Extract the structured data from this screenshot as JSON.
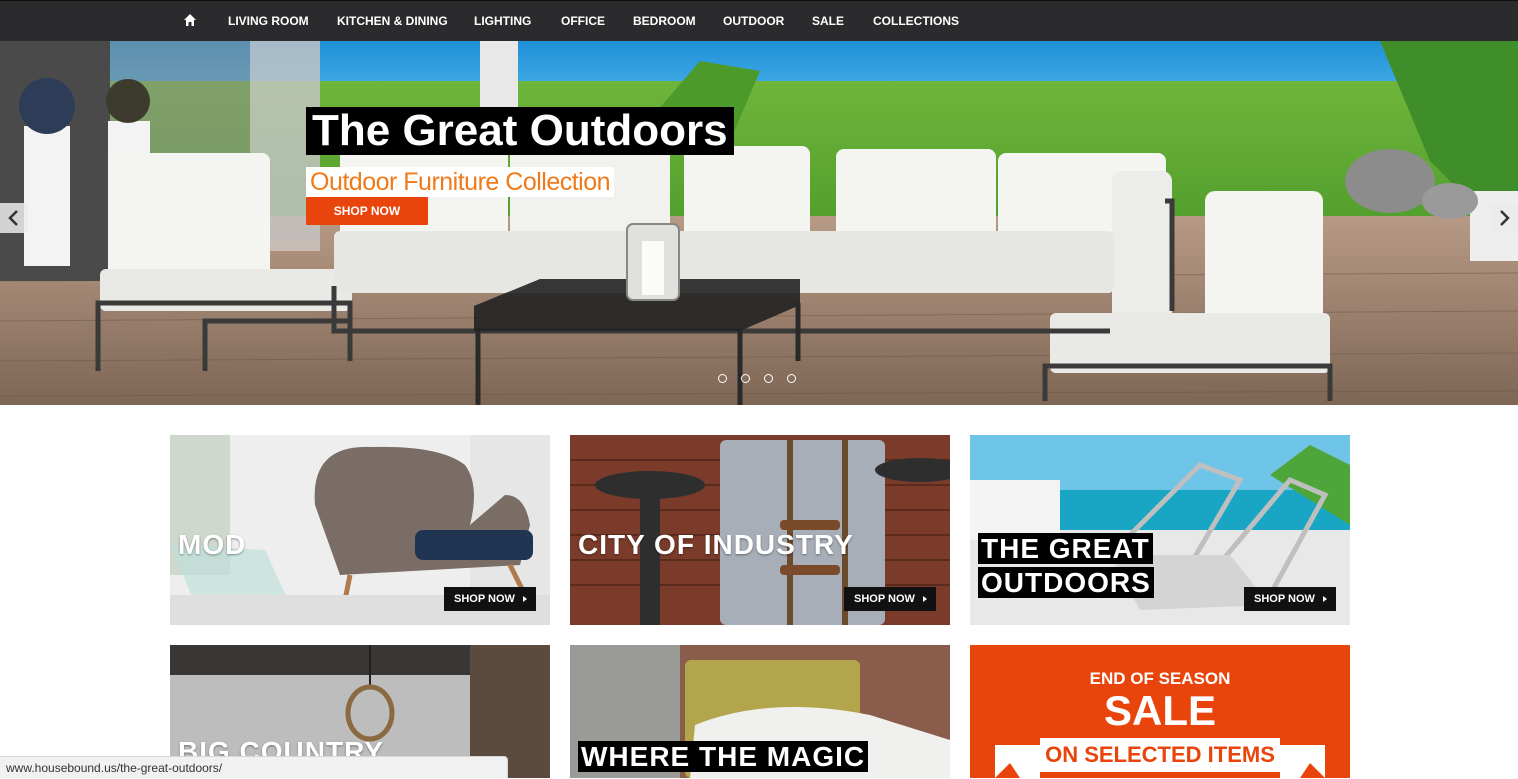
{
  "nav": {
    "home_icon": "home-icon",
    "items": [
      "LIVING ROOM",
      "KITCHEN & DINING",
      "LIGHTING",
      "OFFICE",
      "BEDROOM",
      "OUTDOOR",
      "SALE",
      "COLLECTIONS"
    ]
  },
  "hero": {
    "title": "The Great Outdoors",
    "subtitle": "Outdoor Furniture Collection",
    "cta": "SHOP NOW",
    "slide_count": 4,
    "prev_icon": "chevron-left-icon",
    "next_icon": "chevron-right-icon"
  },
  "tiles": [
    {
      "label": "MOD",
      "cta": "SHOP NOW"
    },
    {
      "label": "CITY OF INDUSTRY",
      "cta": "SHOP NOW"
    },
    {
      "label_line1": "THE GREAT",
      "label_line2": "OUTDOORS",
      "cta": "SHOP NOW"
    },
    {
      "label": "BIG COUNTRY"
    },
    {
      "label": "WHERE THE MAGIC"
    }
  ],
  "sale": {
    "line1": "END OF SEASON",
    "line2": "SALE",
    "line3": "ON SELECTED ITEMS"
  },
  "status_url": "www.housebound.us/the-great-outdoors/",
  "colors": {
    "nav_bg": "#2b2b2d",
    "accent_orange": "#e9440c",
    "subtitle_orange": "#f07a18"
  }
}
